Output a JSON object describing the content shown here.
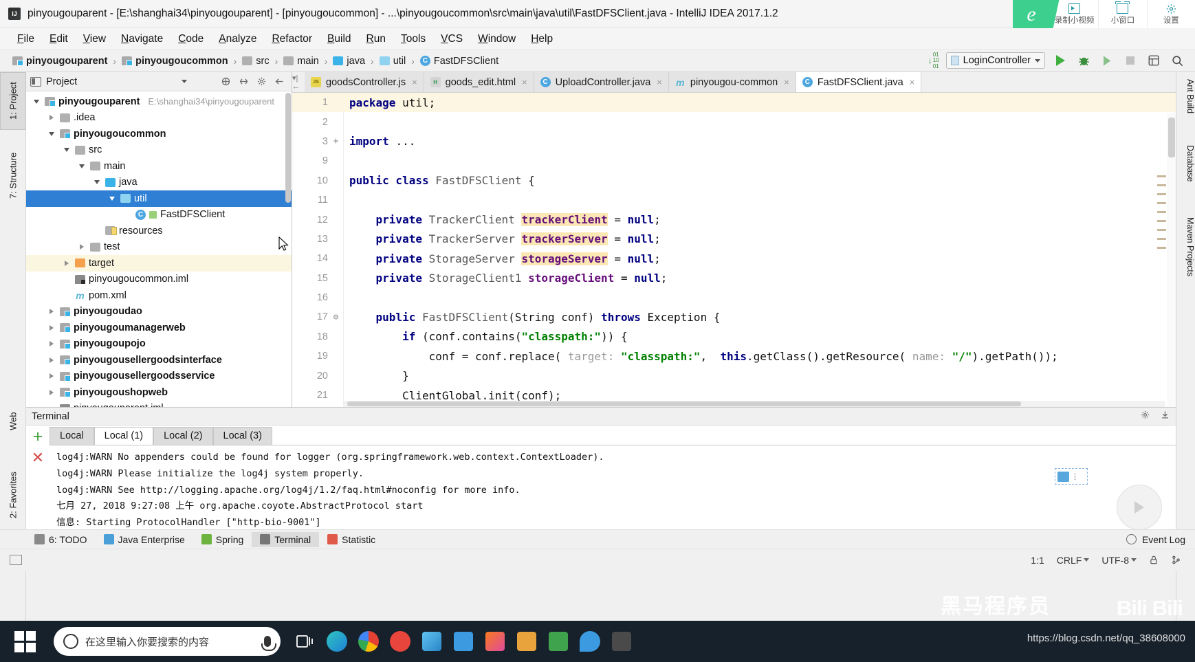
{
  "window": {
    "title": "pinyougouparent - [E:\\shanghai34\\pinyougouparent] - [pinyougoucommon] - ...\\pinyougoucommon\\src\\main\\java\\util\\FastDFSClient.java - IntelliJ IDEA 2017.1.2",
    "logo_label": "IJ"
  },
  "recorder": {
    "brand": "e",
    "items": [
      {
        "label": "录制小视频",
        "icon": "video-record-icon"
      },
      {
        "label": "小窗口",
        "icon": "mini-window-icon"
      },
      {
        "label": "设置",
        "icon": "gear-icon"
      }
    ]
  },
  "menubar": {
    "items": [
      "File",
      "Edit",
      "View",
      "Navigate",
      "Code",
      "Analyze",
      "Refactor",
      "Build",
      "Run",
      "Tools",
      "VCS",
      "Window",
      "Help"
    ]
  },
  "navbar": {
    "breadcrumbs": [
      {
        "label": "pinyougouparent",
        "icon": "module-icon",
        "bold": true
      },
      {
        "label": "pinyougoucommon",
        "icon": "module-icon",
        "bold": true
      },
      {
        "label": "src",
        "icon": "folder-icon",
        "bold": false
      },
      {
        "label": "main",
        "icon": "folder-icon",
        "bold": false
      },
      {
        "label": "java",
        "icon": "source-folder-icon",
        "bold": false
      },
      {
        "label": "util",
        "icon": "package-folder-icon",
        "bold": false
      },
      {
        "label": "FastDFSClient",
        "icon": "java-class-icon",
        "bold": false
      }
    ],
    "separator": "›",
    "run_config": "LoginController",
    "buttons": [
      "run-button",
      "debug-button",
      "run-with-coverage-button",
      "stop-button",
      "layout-button",
      "search-button"
    ]
  },
  "left_tool_strip": [
    {
      "label": "1: Project",
      "selected": true
    },
    {
      "label": "7: Structure",
      "selected": false
    },
    {
      "label": "2: Favorites",
      "selected": false
    },
    {
      "label": "Web",
      "selected": false
    }
  ],
  "right_tool_strip": [
    "Ant Build",
    "Database",
    "Maven Projects"
  ],
  "project_panel": {
    "title": "Project",
    "tools": [
      "collapse-all-icon",
      "expand-icon",
      "settings-icon",
      "hide-icon"
    ],
    "tree": [
      {
        "indent": 0,
        "arrow": "down",
        "icon": "module-icon",
        "label": "pinyougouparent",
        "bold": true,
        "path": "E:\\shanghai34\\pinyougouparent",
        "state": ""
      },
      {
        "indent": 1,
        "arrow": "right",
        "icon": "folder-icon",
        "label": ".idea",
        "bold": false,
        "path": "",
        "state": ""
      },
      {
        "indent": 1,
        "arrow": "down",
        "icon": "module-icon",
        "label": "pinyougoucommon",
        "bold": true,
        "path": "",
        "state": ""
      },
      {
        "indent": 2,
        "arrow": "down",
        "icon": "folder-icon",
        "label": "src",
        "bold": false,
        "path": "",
        "state": ""
      },
      {
        "indent": 3,
        "arrow": "down",
        "icon": "folder-icon",
        "label": "main",
        "bold": false,
        "path": "",
        "state": ""
      },
      {
        "indent": 4,
        "arrow": "down",
        "icon": "source-folder-icon",
        "label": "java",
        "bold": false,
        "path": "",
        "state": ""
      },
      {
        "indent": 5,
        "arrow": "down",
        "icon": "package-folder-icon",
        "label": "util",
        "bold": false,
        "path": "",
        "state": "selected"
      },
      {
        "indent": 6,
        "arrow": "none",
        "icon": "java-class-icon",
        "label": "FastDFSClient",
        "bold": false,
        "path": "",
        "state": ""
      },
      {
        "indent": 4,
        "arrow": "none",
        "icon": "resources-icon",
        "label": "resources",
        "bold": false,
        "path": "",
        "state": ""
      },
      {
        "indent": 3,
        "arrow": "right",
        "icon": "folder-icon",
        "label": "test",
        "bold": false,
        "path": "",
        "state": ""
      },
      {
        "indent": 2,
        "arrow": "right",
        "icon": "target-folder-icon",
        "label": "target",
        "bold": false,
        "path": "",
        "state": "highlight"
      },
      {
        "indent": 2,
        "arrow": "none",
        "icon": "iml-file-icon",
        "label": "pinyougoucommon.iml",
        "bold": false,
        "path": "",
        "state": ""
      },
      {
        "indent": 2,
        "arrow": "none",
        "icon": "maven-file-icon",
        "label": "pom.xml",
        "bold": false,
        "path": "",
        "state": ""
      },
      {
        "indent": 1,
        "arrow": "right",
        "icon": "module-icon",
        "label": "pinyougoudao",
        "bold": true,
        "path": "",
        "state": ""
      },
      {
        "indent": 1,
        "arrow": "right",
        "icon": "module-icon",
        "label": "pinyougoumanagerweb",
        "bold": true,
        "path": "",
        "state": ""
      },
      {
        "indent": 1,
        "arrow": "right",
        "icon": "module-icon",
        "label": "pinyougoupojo",
        "bold": true,
        "path": "",
        "state": ""
      },
      {
        "indent": 1,
        "arrow": "right",
        "icon": "module-icon",
        "label": "pinyougousellergoodsinterface",
        "bold": true,
        "path": "",
        "state": ""
      },
      {
        "indent": 1,
        "arrow": "right",
        "icon": "module-icon",
        "label": "pinyougousellergoodsservice",
        "bold": true,
        "path": "",
        "state": ""
      },
      {
        "indent": 1,
        "arrow": "right",
        "icon": "module-icon",
        "label": "pinyougoushopweb",
        "bold": true,
        "path": "",
        "state": ""
      },
      {
        "indent": 1,
        "arrow": "none",
        "icon": "iml-file-icon",
        "label": "pinyougouparent.iml",
        "bold": false,
        "path": "",
        "state": ""
      }
    ]
  },
  "editor": {
    "tabs": [
      {
        "label": "goodsController.js",
        "icon": "js-file-icon",
        "active": false,
        "close": "×"
      },
      {
        "label": "goods_edit.html",
        "icon": "html-file-icon",
        "active": false,
        "close": "×"
      },
      {
        "label": "UploadController.java",
        "icon": "java-class-icon",
        "active": false,
        "close": "×"
      },
      {
        "label": "pinyougou-common",
        "icon": "maven-file-icon",
        "active": false,
        "close": "×"
      },
      {
        "label": "FastDFSClient.java",
        "icon": "java-class-icon",
        "active": true,
        "close": "×"
      }
    ],
    "lines": [
      {
        "n": "1",
        "fold": "",
        "current": true,
        "parts": [
          {
            "t": "package ",
            "c": "kw"
          },
          {
            "t": "util",
            "c": "pln"
          },
          {
            "t": ";",
            "c": "pln"
          }
        ]
      },
      {
        "n": "2",
        "fold": "",
        "current": false,
        "parts": []
      },
      {
        "n": "3",
        "fold": "+",
        "current": false,
        "parts": [
          {
            "t": "import ",
            "c": "kw"
          },
          {
            "t": "...",
            "c": "pln"
          }
        ]
      },
      {
        "n": "9",
        "fold": "",
        "current": false,
        "parts": []
      },
      {
        "n": "10",
        "fold": "",
        "current": false,
        "parts": [
          {
            "t": "public class ",
            "c": "kw"
          },
          {
            "t": "FastDFSClient",
            "c": "cls"
          },
          {
            "t": " {",
            "c": "pln"
          }
        ]
      },
      {
        "n": "11",
        "fold": "",
        "current": false,
        "parts": []
      },
      {
        "n": "12",
        "fold": "",
        "current": false,
        "parts": [
          {
            "t": "    ",
            "c": "pln"
          },
          {
            "t": "private ",
            "c": "kw"
          },
          {
            "t": "TrackerClient ",
            "c": "cls"
          },
          {
            "t": "trackerClient",
            "c": "fldhl"
          },
          {
            "t": " = ",
            "c": "pln"
          },
          {
            "t": "null",
            "c": "kw"
          },
          {
            "t": ";",
            "c": "pln"
          }
        ]
      },
      {
        "n": "13",
        "fold": "",
        "current": false,
        "parts": [
          {
            "t": "    ",
            "c": "pln"
          },
          {
            "t": "private ",
            "c": "kw"
          },
          {
            "t": "TrackerServer ",
            "c": "cls"
          },
          {
            "t": "trackerServer",
            "c": "fldhl"
          },
          {
            "t": " = ",
            "c": "pln"
          },
          {
            "t": "null",
            "c": "kw"
          },
          {
            "t": ";",
            "c": "pln"
          }
        ]
      },
      {
        "n": "14",
        "fold": "",
        "current": false,
        "parts": [
          {
            "t": "    ",
            "c": "pln"
          },
          {
            "t": "private ",
            "c": "kw"
          },
          {
            "t": "StorageServer ",
            "c": "cls"
          },
          {
            "t": "storageServer",
            "c": "fldhl"
          },
          {
            "t": " = ",
            "c": "pln"
          },
          {
            "t": "null",
            "c": "kw"
          },
          {
            "t": ";",
            "c": "pln"
          }
        ]
      },
      {
        "n": "15",
        "fold": "",
        "current": false,
        "parts": [
          {
            "t": "    ",
            "c": "pln"
          },
          {
            "t": "private ",
            "c": "kw"
          },
          {
            "t": "StorageClient1 ",
            "c": "cls"
          },
          {
            "t": "storageClient",
            "c": "fld"
          },
          {
            "t": " = ",
            "c": "pln"
          },
          {
            "t": "null",
            "c": "kw"
          },
          {
            "t": ";",
            "c": "pln"
          }
        ]
      },
      {
        "n": "16",
        "fold": "",
        "current": false,
        "parts": []
      },
      {
        "n": "17",
        "fold": "⊖",
        "current": false,
        "parts": [
          {
            "t": "    ",
            "c": "pln"
          },
          {
            "t": "public ",
            "c": "kw"
          },
          {
            "t": "FastDFSClient",
            "c": "cls"
          },
          {
            "t": "(String conf) ",
            "c": "pln"
          },
          {
            "t": "throws ",
            "c": "kw"
          },
          {
            "t": "Exception {",
            "c": "pln"
          }
        ]
      },
      {
        "n": "18",
        "fold": "",
        "current": false,
        "parts": [
          {
            "t": "        ",
            "c": "pln"
          },
          {
            "t": "if ",
            "c": "kw"
          },
          {
            "t": "(conf.contains(",
            "c": "pln"
          },
          {
            "t": "\"classpath:\"",
            "c": "str"
          },
          {
            "t": ")) {",
            "c": "pln"
          }
        ]
      },
      {
        "n": "19",
        "fold": "",
        "current": false,
        "parts": [
          {
            "t": "            conf = conf.replace( ",
            "c": "pln"
          },
          {
            "t": "target: ",
            "c": "hint"
          },
          {
            "t": "\"classpath:\"",
            "c": "str"
          },
          {
            "t": ",  ",
            "c": "pln"
          },
          {
            "t": "this",
            "c": "kw"
          },
          {
            "t": ".getClass().getResource( ",
            "c": "pln"
          },
          {
            "t": "name: ",
            "c": "hint"
          },
          {
            "t": "\"/\"",
            "c": "str"
          },
          {
            "t": ").getPath());",
            "c": "pln"
          }
        ]
      },
      {
        "n": "20",
        "fold": "",
        "current": false,
        "parts": [
          {
            "t": "        }",
            "c": "pln"
          }
        ]
      },
      {
        "n": "21",
        "fold": "",
        "current": false,
        "parts": [
          {
            "t": "        ClientGlobal.init(conf);",
            "c": "pln"
          }
        ]
      }
    ]
  },
  "terminal": {
    "title": "Terminal",
    "tabs": [
      {
        "label": "Local",
        "active": false
      },
      {
        "label": "Local (1)",
        "active": true
      },
      {
        "label": "Local (2)",
        "active": false
      },
      {
        "label": "Local (3)",
        "active": false
      }
    ],
    "add_label": "+",
    "close_label": "✕",
    "output": [
      "log4j:WARN No appenders could be found for logger (org.springframework.web.context.ContextLoader).",
      "log4j:WARN Please initialize the log4j system properly.",
      "log4j:WARN See http://logging.apache.org/log4j/1.2/faq.html#noconfig for more info.",
      "七月 27, 2018 9:27:08 上午 org.apache.coyote.AbstractProtocol start",
      "信息: Starting ProtocolHandler [\"http-bio-9001\"]"
    ]
  },
  "statusbar": {
    "items": [
      {
        "label": "6: TODO",
        "icon": "todo-icon",
        "active": false
      },
      {
        "label": "Java Enterprise",
        "icon": "jee-icon",
        "active": false
      },
      {
        "label": "Spring",
        "icon": "spring-icon",
        "active": false
      },
      {
        "label": "Terminal",
        "icon": "terminal-icon",
        "active": true
      },
      {
        "label": "Statistic",
        "icon": "statistic-icon",
        "active": false
      }
    ],
    "event_log": "Event Log",
    "caret": "1:1",
    "line_sep": "CRLF",
    "encoding": "UTF-8"
  },
  "taskbar": {
    "search_placeholder": "在这里输入你要搜索的内容",
    "icons": [
      "task-view-icon",
      "edge-icon",
      "chrome-icon",
      "opera-icon",
      "app-blue-icon",
      "folder-icon",
      "idea-icon",
      "pdf-icon",
      "editor-icon",
      "water-icon",
      "cmd-icon"
    ]
  },
  "watermark": {
    "brand_cn": "黑马程序员",
    "brand_bili": "Bili Bili",
    "url": "https://blog.csdn.net/qq_38608000"
  },
  "colors": {
    "accent_blue": "#2f7fd4",
    "keyword": "#000080",
    "string": "#008000",
    "field": "#660e7a",
    "field_highlight": "#fbe7b4",
    "taskbar": "#17212b",
    "recorder_green": "#3dcf8e"
  }
}
